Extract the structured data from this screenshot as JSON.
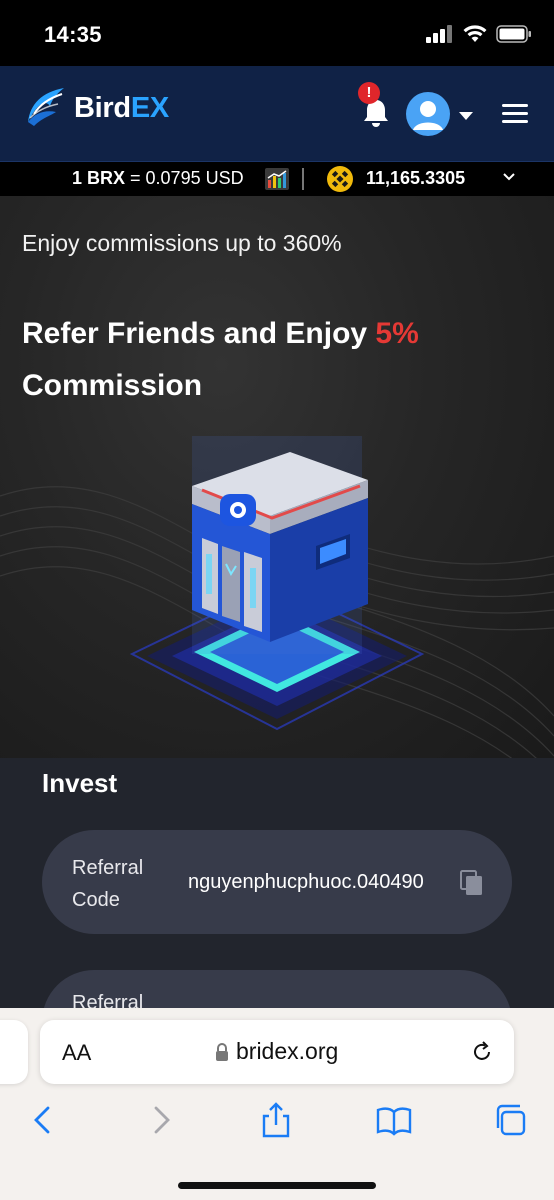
{
  "status_bar": {
    "time": "14:35"
  },
  "header": {
    "logo_bird": "Bird",
    "logo_ex": "EX",
    "notification_badge": "!"
  },
  "ticker": {
    "pair": "1 BRX",
    "rate": " = 0.0795 USD",
    "balance": "11,165.3305"
  },
  "hero": {
    "subtitle": "Enjoy commissions up to 360%",
    "title_prefix": "Refer Friends and Enjoy ",
    "title_highlight": "5%",
    "title_suffix": " Commission"
  },
  "invest": {
    "title": "Invest",
    "referral_code_label": "Referral Code",
    "referral_code_value": "nguyenphucphuoc.040490",
    "second_card_label": "Referral"
  },
  "safari": {
    "text_size_label": "AA",
    "url": "bridex.org"
  },
  "colors": {
    "header_bg": "#102246",
    "accent_blue": "#2aa3ff",
    "highlight_red": "#e53935",
    "card_bg": "#373b4a",
    "safari_blue": "#1a7cf5"
  }
}
